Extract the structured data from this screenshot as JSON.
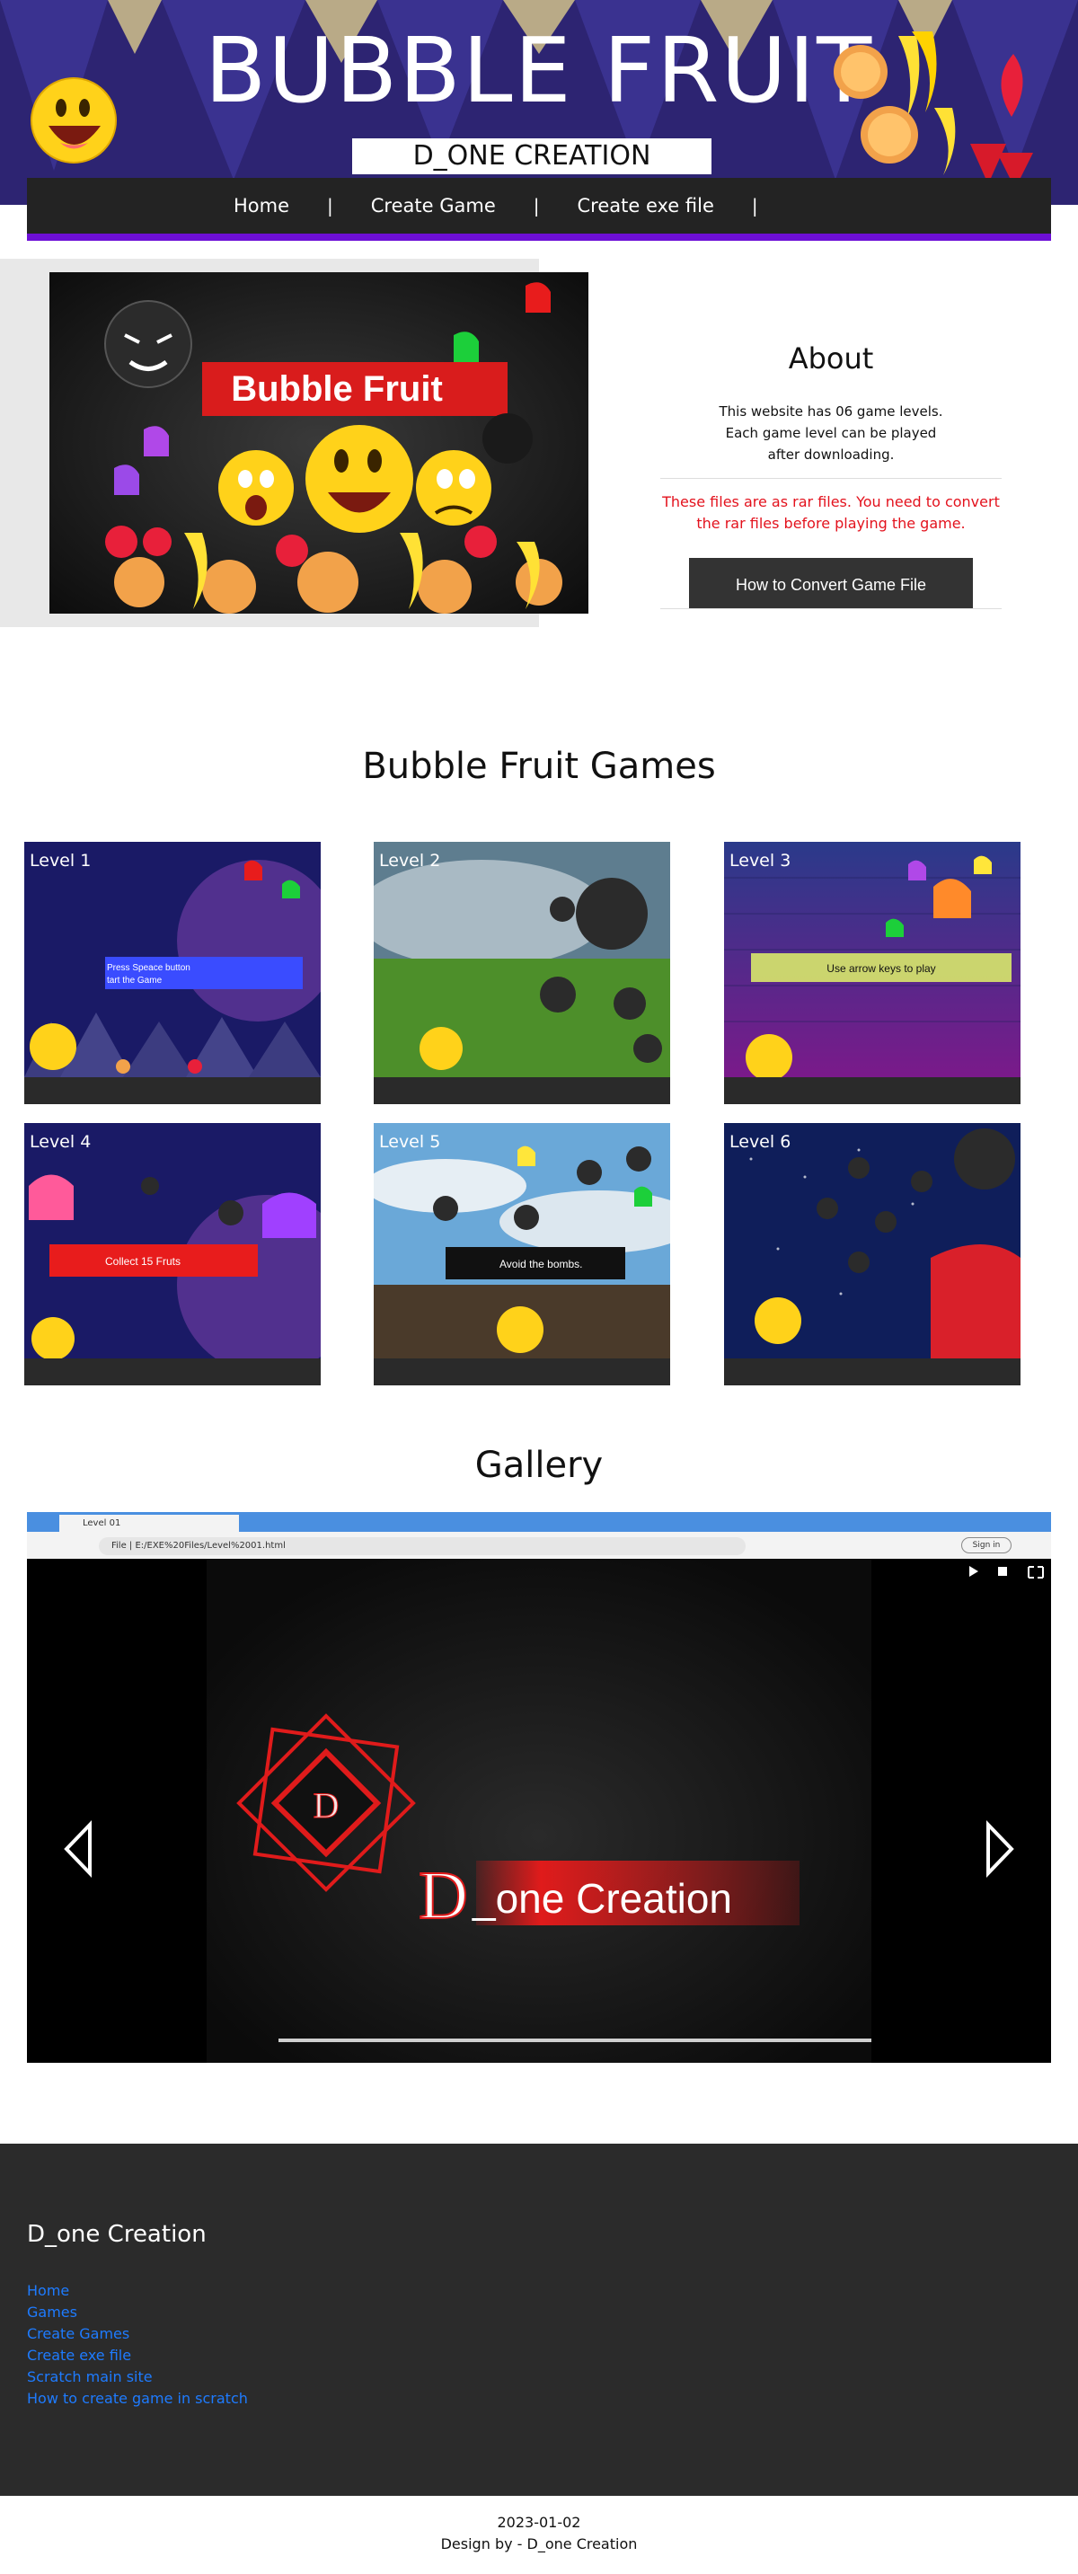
{
  "header": {
    "title": "BUBBLE FRUIT",
    "subtitle": "D_ONE CREATION"
  },
  "nav": {
    "items": [
      {
        "label": "Home"
      },
      {
        "label": "Create Game"
      },
      {
        "label": "Create exe file"
      }
    ],
    "separator": "|"
  },
  "hero": {
    "image_title": "Bubble Fruit"
  },
  "about": {
    "heading": "About",
    "description": "This website has 06 game levels. Each game level can be played after downloading.",
    "warning": "These files are as rar files. You need to convert the rar files before playing the game.",
    "button_label": "How to Convert Game File"
  },
  "games": {
    "heading": "Bubble Fruit Games",
    "levels": [
      {
        "label": "Level 1",
        "caption": "Press Speace button\ntart the Game"
      },
      {
        "label": "Level 2",
        "caption": ""
      },
      {
        "label": "Level 3",
        "caption": "Use arrow keys to play"
      },
      {
        "label": "Level 4",
        "caption": "Collect 15 Fruts"
      },
      {
        "label": "Level 5",
        "caption": "Avoid the bombs."
      },
      {
        "label": "Level 6",
        "caption": ""
      }
    ]
  },
  "gallery": {
    "heading": "Gallery",
    "tab_title": "Level 01",
    "address": "File  |  E:/EXE%20Files/Level%2001.html",
    "sign_in": "Sign in",
    "logo_letter": "D",
    "logo_text_big": "D",
    "logo_text_rest": "_one  Creation"
  },
  "footer": {
    "brand": "D_one Creation",
    "links": [
      "Home",
      "Games",
      "Create Games",
      "Create exe file",
      "Scratch main site",
      "How to create game in scratch"
    ]
  },
  "copyright": {
    "date": "2023-01-02",
    "credit": "Design by - D_one Creation"
  },
  "colors": {
    "header_bg": "#2d2472",
    "nav_bg": "#232323",
    "nav_underline": "#6d0fd6",
    "warning": "#e3121d",
    "footer_bg": "#2b2b2b",
    "footer_link": "#1e7bff"
  }
}
